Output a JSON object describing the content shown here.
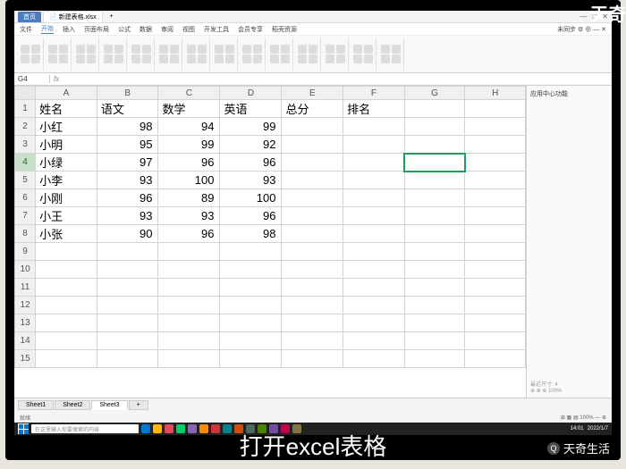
{
  "watermarks": {
    "corner": "天奇",
    "bottom": "天奇生活"
  },
  "caption": "打开excel表格",
  "tabs": {
    "home": "首页",
    "doc_icon": "📄",
    "doc_name": "新建表格.xlsx",
    "plus": "+"
  },
  "win_controls": [
    "—",
    "□",
    "✕"
  ],
  "menu": [
    "文件",
    "开始",
    "插入",
    "页面布局",
    "公式",
    "数据",
    "审阅",
    "视图",
    "开发工具",
    "会员专享",
    "稻壳资源"
  ],
  "menu_right": "未同步 ⚙ ⊕ — ✕",
  "namebox": "G4",
  "fx_label": "fx",
  "side_panel": {
    "title": "应用中心功能",
    "bottom1": "最近尺寸: 4",
    "bottom2": "⊕ ⊕ ⊕ 100%"
  },
  "columns": [
    "A",
    "B",
    "C",
    "D",
    "E",
    "F",
    "G",
    "H"
  ],
  "active_row": 4,
  "selected_cell": {
    "row": 4,
    "col": "G"
  },
  "chart_data": {
    "type": "table",
    "headers": [
      "姓名",
      "语文",
      "数学",
      "英语",
      "总分",
      "排名"
    ],
    "rows": [
      {
        "name": "小红",
        "chinese": 98,
        "math": 94,
        "english": 99
      },
      {
        "name": "小明",
        "chinese": 95,
        "math": 99,
        "english": 92
      },
      {
        "name": "小绿",
        "chinese": 97,
        "math": 96,
        "english": 96
      },
      {
        "name": "小李",
        "chinese": 93,
        "math": 100,
        "english": 93
      },
      {
        "name": "小刚",
        "chinese": 96,
        "math": 89,
        "english": 100
      },
      {
        "name": "小王",
        "chinese": 93,
        "math": 93,
        "english": 96
      },
      {
        "name": "小张",
        "chinese": 90,
        "math": 96,
        "english": 98
      }
    ]
  },
  "total_rows": 15,
  "sheet_tabs": [
    "Sheet1",
    "Sheet2",
    "Sheet3"
  ],
  "active_sheet": 2,
  "statusbar": {
    "left": "就绪",
    "right": "⊞ ▦ ▤ 100% — ⊕"
  },
  "taskbar": {
    "search": "在这里输入你要搜索的内容",
    "time": "14:01",
    "date": "2022/1/7"
  },
  "taskbar_icons": [
    "#0078d4",
    "#ffb900",
    "#e74856",
    "#00cc6a",
    "#8764b8",
    "#ff8c00",
    "#d13438",
    "#038387",
    "#ca5010",
    "#486860",
    "#498205",
    "#744da9",
    "#c30052",
    "#847545"
  ]
}
